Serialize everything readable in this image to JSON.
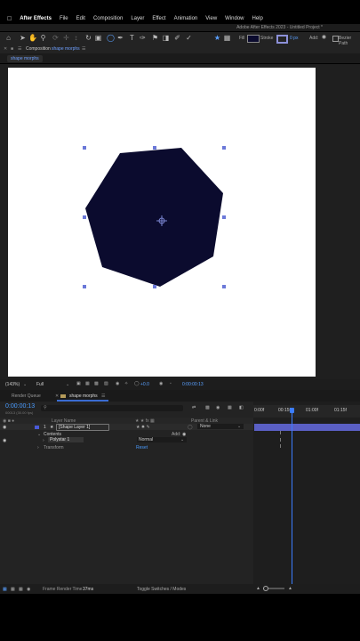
{
  "menubar": {
    "apple": "",
    "app_name": "After Effects",
    "items": [
      "File",
      "Edit",
      "Composition",
      "Layer",
      "Effect",
      "Animation",
      "View",
      "Window",
      "Help"
    ]
  },
  "titlebar": {
    "title": "Adobe After Effects 2023 - Untitled Project *"
  },
  "toolbar": {
    "fill_label": "Fill",
    "stroke_label": "Stroke",
    "stroke_width": "0 px",
    "add_label": "Add:",
    "bezier_label": "Bezier Path",
    "fill_color": "#0b0b2e"
  },
  "comp_panel": {
    "title_prefix": "Composition",
    "comp_name": "shape morphs",
    "tab_label": "shape morphs"
  },
  "canvas": {
    "shape_color": "#0b0b2e",
    "background": "#ffffff"
  },
  "viewer_bar": {
    "zoom": "(143%)",
    "resolution": "Full",
    "exposure": "+0.0",
    "timecode": "0:00:00:13"
  },
  "timeline_tabs": {
    "render_queue": "Render Queue",
    "comp_tab": "shape morphs"
  },
  "timeline": {
    "timecode": "0:00:00:13",
    "frame_info": "00013 (30.00 fps)",
    "col_layer_name": "Layer Name",
    "col_parent": "Parent & Link",
    "ruler_labels": [
      "0:00f",
      "00:15f",
      "01:00f",
      "01:15f"
    ],
    "layer": {
      "index": "1",
      "name": "[Shape Layer 1]",
      "parent": "None"
    },
    "contents_label": "Contents",
    "add_label": "Add:",
    "polystar_label": "Polystar 1",
    "blend_mode": "Normal",
    "transform_label": "Transform",
    "reset_label": "Reset",
    "playhead_fraction": 0.36
  },
  "footer": {
    "frame_render_label": "Frame Render Time",
    "frame_render_value": "37ms",
    "toggle_label": "Toggle Switches / Modes"
  }
}
